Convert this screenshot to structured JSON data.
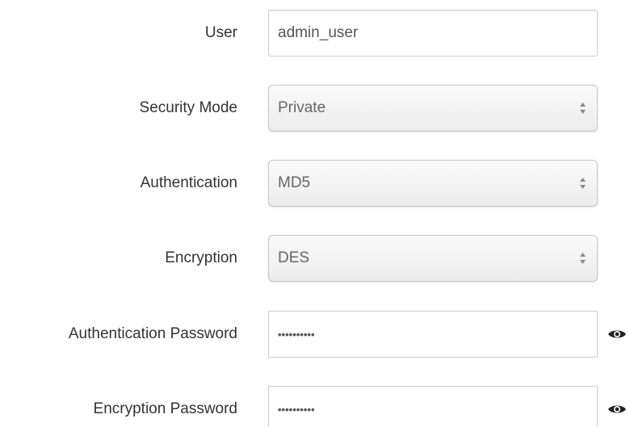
{
  "form": {
    "user": {
      "label": "User",
      "value": "admin_user"
    },
    "security_mode": {
      "label": "Security Mode",
      "selected": "Private"
    },
    "authentication": {
      "label": "Authentication",
      "selected": "MD5"
    },
    "encryption": {
      "label": "Encryption",
      "selected": "DES"
    },
    "auth_password": {
      "label": "Authentication Password",
      "masked_value": "••••••••••"
    },
    "enc_password": {
      "label": "Encryption Password",
      "masked_value": "••••••••••"
    }
  },
  "icons": {
    "select_arrows": "up-down-chevron-icon",
    "reveal_password": "eye-icon"
  }
}
